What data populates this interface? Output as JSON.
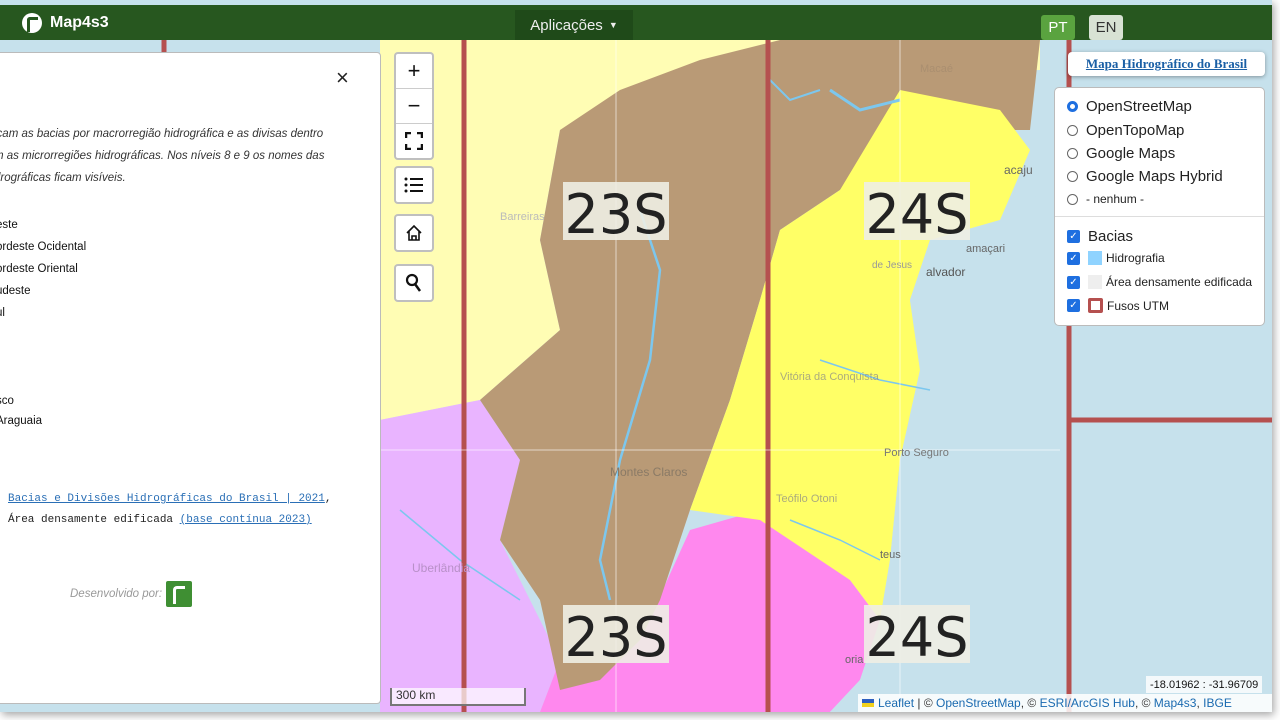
{
  "app": {
    "brand": "Map4s3",
    "apps_menu": "Aplicações",
    "lang_pt": "PT",
    "lang_en": "EN"
  },
  "panel": {
    "close": "×",
    "description": [
      "icam as bacias por macrorregião hidrográfica e as divisas dentro",
      "m as microrregiões hidrográficas. Nos níveis 8 e 9 os nomes das",
      "drográficas ficam visíveis."
    ],
    "legend": [
      "este",
      "ordeste Ocidental",
      "ordeste Oriental",
      "udeste",
      "ul",
      "sco",
      "Araguaia"
    ],
    "sources_link": "Bacias e Divisões Hidrográficas do Brasil | 2021",
    "sources_sep": ",",
    "area_text": "Área densamente edificada",
    "area_link": "(base contínua 2023)",
    "developed_by": "Desenvolvido por:"
  },
  "controls": {
    "zoom_in": "+",
    "zoom_out": "−"
  },
  "map_title": "Mapa Hidrográfico do Brasil",
  "layers": {
    "base": [
      {
        "label": "OpenStreetMap",
        "selected": true
      },
      {
        "label": "OpenTopoMap",
        "selected": false
      },
      {
        "label": "Google Maps",
        "selected": false
      },
      {
        "label": "Google Maps Hybrid",
        "selected": false
      },
      {
        "label": "- nenhum -",
        "selected": false
      }
    ],
    "overlays": [
      {
        "label": "Bacias",
        "checked": true
      },
      {
        "label": "Hidrografia",
        "checked": true,
        "color": "#8fd3ff"
      },
      {
        "label": "Área densamente edificada",
        "checked": true,
        "color": "#eeeeee"
      },
      {
        "label": "Fusos UTM",
        "checked": true,
        "color": "#b5504f"
      }
    ]
  },
  "utm_zones": [
    "23S",
    "24S",
    "23S",
    "24S"
  ],
  "place_labels": [
    "acaju",
    "amaçari",
    "alvador",
    "Porto Seguro",
    "teus",
    "oria",
    "Teófilo Otoni",
    "Vitória da Conquista",
    "Montes Claros",
    "Uberlândia",
    "de Jesus",
    "Barreiras",
    "Macaé"
  ],
  "scale": "300 km",
  "coords": "-18.01962 : -31.96709",
  "attribution": {
    "leaflet": "Leaflet",
    "sep1": " | © ",
    "osm": "OpenStreetMap",
    "sep2": ", © ",
    "esri": "ESRI/ArcGIS Hub",
    "sep3": ", © ",
    "m4": "Map4s3",
    "sep4": ", ",
    "ibge": "IBGE"
  },
  "colors": {
    "topbar": "#27571f",
    "sao_francisco": "#b99a76",
    "atlantico_leste": "#ffff66",
    "parana": "#e9b4ff",
    "sudeste": "#ff88ee",
    "tocantins": "#fffdb4",
    "sea": "#c6e1ec",
    "utm_line": "#b5504f"
  }
}
